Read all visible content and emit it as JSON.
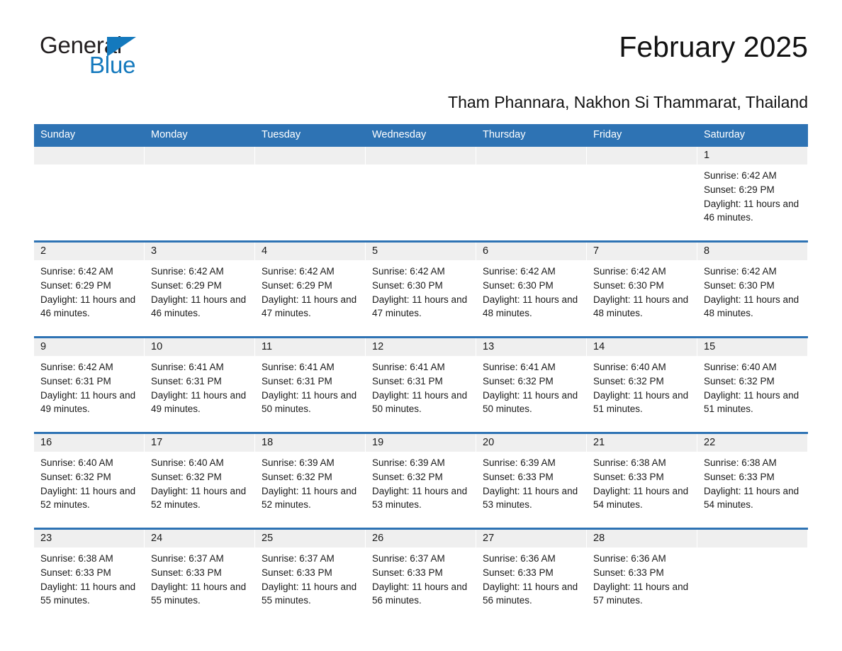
{
  "brand": {
    "name_part1": "General",
    "name_part2": "Blue",
    "triangle_icon": "triangle-icon",
    "accent_color": "#1479bd"
  },
  "header": {
    "title": "February 2025",
    "subtitle": "Tham Phannara, Nakhon Si Thammarat, Thailand"
  },
  "colors": {
    "header_blue": "#2e73b4",
    "daynum_gray": "#efefef",
    "text": "#1a1a1a",
    "logo_blue": "#1479bd"
  },
  "weekdays": [
    "Sunday",
    "Monday",
    "Tuesday",
    "Wednesday",
    "Thursday",
    "Friday",
    "Saturday"
  ],
  "labels": {
    "sunrise_prefix": "Sunrise: ",
    "sunset_prefix": "Sunset: ",
    "daylight_prefix": "Daylight: "
  },
  "weeks": [
    [
      {
        "day": "",
        "empty": true
      },
      {
        "day": "",
        "empty": true
      },
      {
        "day": "",
        "empty": true
      },
      {
        "day": "",
        "empty": true
      },
      {
        "day": "",
        "empty": true
      },
      {
        "day": "",
        "empty": true
      },
      {
        "day": "1",
        "sunrise": "Sunrise: 6:42 AM",
        "sunset": "Sunset: 6:29 PM",
        "daylight": "Daylight: 11 hours and 46 minutes."
      }
    ],
    [
      {
        "day": "2",
        "sunrise": "Sunrise: 6:42 AM",
        "sunset": "Sunset: 6:29 PM",
        "daylight": "Daylight: 11 hours and 46 minutes."
      },
      {
        "day": "3",
        "sunrise": "Sunrise: 6:42 AM",
        "sunset": "Sunset: 6:29 PM",
        "daylight": "Daylight: 11 hours and 46 minutes."
      },
      {
        "day": "4",
        "sunrise": "Sunrise: 6:42 AM",
        "sunset": "Sunset: 6:29 PM",
        "daylight": "Daylight: 11 hours and 47 minutes."
      },
      {
        "day": "5",
        "sunrise": "Sunrise: 6:42 AM",
        "sunset": "Sunset: 6:30 PM",
        "daylight": "Daylight: 11 hours and 47 minutes."
      },
      {
        "day": "6",
        "sunrise": "Sunrise: 6:42 AM",
        "sunset": "Sunset: 6:30 PM",
        "daylight": "Daylight: 11 hours and 48 minutes."
      },
      {
        "day": "7",
        "sunrise": "Sunrise: 6:42 AM",
        "sunset": "Sunset: 6:30 PM",
        "daylight": "Daylight: 11 hours and 48 minutes."
      },
      {
        "day": "8",
        "sunrise": "Sunrise: 6:42 AM",
        "sunset": "Sunset: 6:30 PM",
        "daylight": "Daylight: 11 hours and 48 minutes."
      }
    ],
    [
      {
        "day": "9",
        "sunrise": "Sunrise: 6:42 AM",
        "sunset": "Sunset: 6:31 PM",
        "daylight": "Daylight: 11 hours and 49 minutes."
      },
      {
        "day": "10",
        "sunrise": "Sunrise: 6:41 AM",
        "sunset": "Sunset: 6:31 PM",
        "daylight": "Daylight: 11 hours and 49 minutes."
      },
      {
        "day": "11",
        "sunrise": "Sunrise: 6:41 AM",
        "sunset": "Sunset: 6:31 PM",
        "daylight": "Daylight: 11 hours and 50 minutes."
      },
      {
        "day": "12",
        "sunrise": "Sunrise: 6:41 AM",
        "sunset": "Sunset: 6:31 PM",
        "daylight": "Daylight: 11 hours and 50 minutes."
      },
      {
        "day": "13",
        "sunrise": "Sunrise: 6:41 AM",
        "sunset": "Sunset: 6:32 PM",
        "daylight": "Daylight: 11 hours and 50 minutes."
      },
      {
        "day": "14",
        "sunrise": "Sunrise: 6:40 AM",
        "sunset": "Sunset: 6:32 PM",
        "daylight": "Daylight: 11 hours and 51 minutes."
      },
      {
        "day": "15",
        "sunrise": "Sunrise: 6:40 AM",
        "sunset": "Sunset: 6:32 PM",
        "daylight": "Daylight: 11 hours and 51 minutes."
      }
    ],
    [
      {
        "day": "16",
        "sunrise": "Sunrise: 6:40 AM",
        "sunset": "Sunset: 6:32 PM",
        "daylight": "Daylight: 11 hours and 52 minutes."
      },
      {
        "day": "17",
        "sunrise": "Sunrise: 6:40 AM",
        "sunset": "Sunset: 6:32 PM",
        "daylight": "Daylight: 11 hours and 52 minutes."
      },
      {
        "day": "18",
        "sunrise": "Sunrise: 6:39 AM",
        "sunset": "Sunset: 6:32 PM",
        "daylight": "Daylight: 11 hours and 52 minutes."
      },
      {
        "day": "19",
        "sunrise": "Sunrise: 6:39 AM",
        "sunset": "Sunset: 6:32 PM",
        "daylight": "Daylight: 11 hours and 53 minutes."
      },
      {
        "day": "20",
        "sunrise": "Sunrise: 6:39 AM",
        "sunset": "Sunset: 6:33 PM",
        "daylight": "Daylight: 11 hours and 53 minutes."
      },
      {
        "day": "21",
        "sunrise": "Sunrise: 6:38 AM",
        "sunset": "Sunset: 6:33 PM",
        "daylight": "Daylight: 11 hours and 54 minutes."
      },
      {
        "day": "22",
        "sunrise": "Sunrise: 6:38 AM",
        "sunset": "Sunset: 6:33 PM",
        "daylight": "Daylight: 11 hours and 54 minutes."
      }
    ],
    [
      {
        "day": "23",
        "sunrise": "Sunrise: 6:38 AM",
        "sunset": "Sunset: 6:33 PM",
        "daylight": "Daylight: 11 hours and 55 minutes."
      },
      {
        "day": "24",
        "sunrise": "Sunrise: 6:37 AM",
        "sunset": "Sunset: 6:33 PM",
        "daylight": "Daylight: 11 hours and 55 minutes."
      },
      {
        "day": "25",
        "sunrise": "Sunrise: 6:37 AM",
        "sunset": "Sunset: 6:33 PM",
        "daylight": "Daylight: 11 hours and 55 minutes."
      },
      {
        "day": "26",
        "sunrise": "Sunrise: 6:37 AM",
        "sunset": "Sunset: 6:33 PM",
        "daylight": "Daylight: 11 hours and 56 minutes."
      },
      {
        "day": "27",
        "sunrise": "Sunrise: 6:36 AM",
        "sunset": "Sunset: 6:33 PM",
        "daylight": "Daylight: 11 hours and 56 minutes."
      },
      {
        "day": "28",
        "sunrise": "Sunrise: 6:36 AM",
        "sunset": "Sunset: 6:33 PM",
        "daylight": "Daylight: 11 hours and 57 minutes."
      },
      {
        "day": "",
        "empty": true
      }
    ]
  ]
}
